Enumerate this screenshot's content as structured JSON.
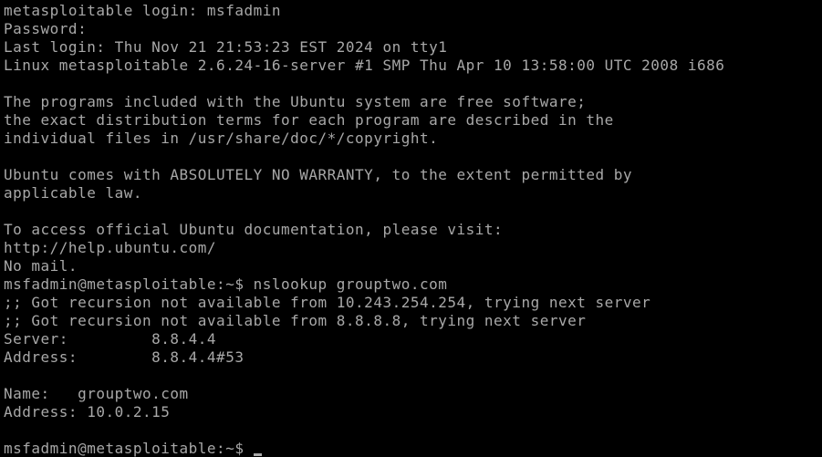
{
  "terminal": {
    "lines": [
      "metasploitable login: msfadmin",
      "Password:",
      "Last login: Thu Nov 21 21:53:23 EST 2024 on tty1",
      "Linux metasploitable 2.6.24-16-server #1 SMP Thu Apr 10 13:58:00 UTC 2008 i686",
      "",
      "The programs included with the Ubuntu system are free software;",
      "the exact distribution terms for each program are described in the",
      "individual files in /usr/share/doc/*/copyright.",
      "",
      "Ubuntu comes with ABSOLUTELY NO WARRANTY, to the extent permitted by",
      "applicable law.",
      "",
      "To access official Ubuntu documentation, please visit:",
      "http://help.ubuntu.com/",
      "No mail.",
      "msfadmin@metasploitable:~$ nslookup grouptwo.com",
      ";; Got recursion not available from 10.243.254.254, trying next server",
      ";; Got recursion not available from 8.8.8.8, trying next server",
      "Server:         8.8.4.4",
      "Address:        8.8.4.4#53",
      "",
      "Name:   grouptwo.com",
      "Address: 10.0.2.15",
      ""
    ],
    "prompt": "msfadmin@metasploitable:~$ ",
    "colors": {
      "background": "#000000",
      "foreground": "#a8a8a8"
    }
  }
}
